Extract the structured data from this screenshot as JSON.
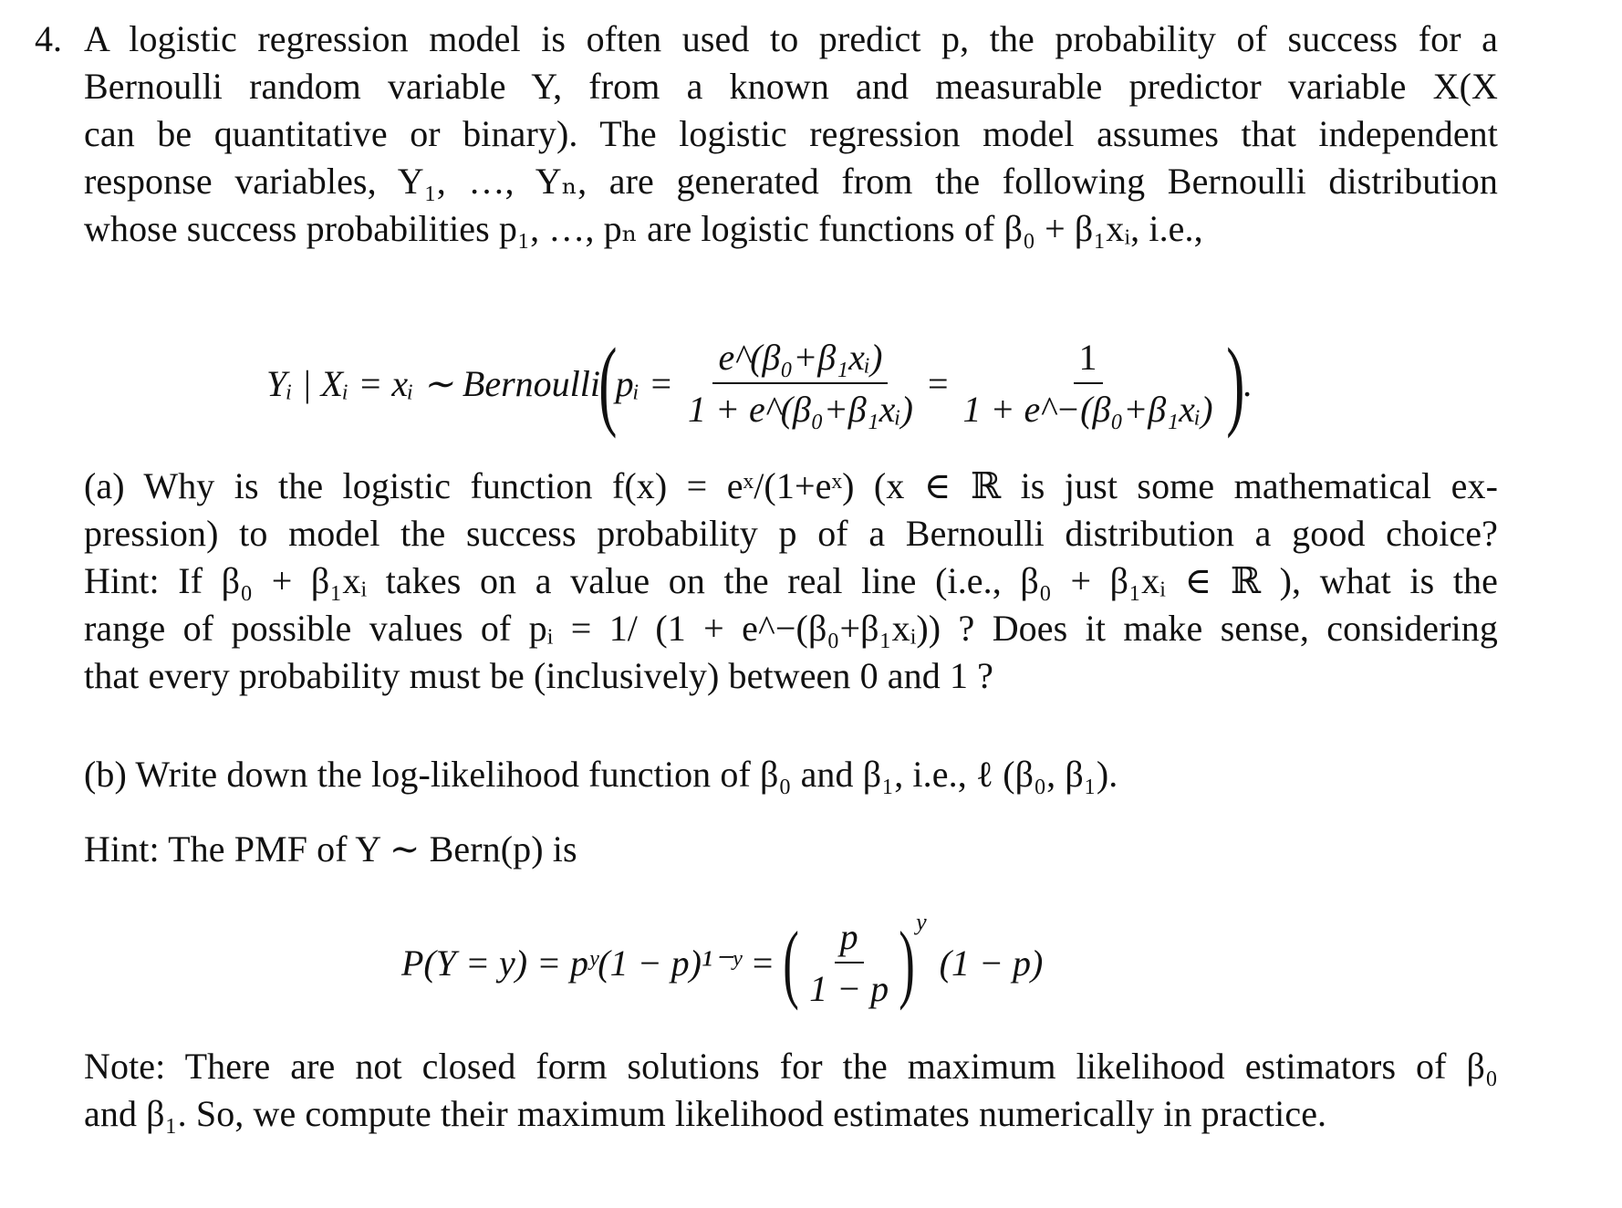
{
  "problem": {
    "number": "4.",
    "intro_lines": [
      "A logistic regression model is often used to predict p, the probability of success for a",
      "Bernoulli random variable Y, from a known and measurable predictor variable X(X",
      "can be quantitative or binary). The logistic regression model assumes that independent",
      "response variables, Y₁, …, Yₙ, are generated from the following Bernoulli distribution",
      "whose success probabilities p₁, …, pₙ are logistic functions of β₀ + β₁xᵢ, i.e.,"
    ],
    "model_equation": {
      "lhs": "Yᵢ | Xᵢ = xᵢ ∼ Bernoulli",
      "pi": "pᵢ =",
      "frac1_num": "e^(β₀+β₁xᵢ)",
      "frac1_den": "1 + e^(β₀+β₁xᵢ)",
      "frac2_num": "1",
      "frac2_den": "1 + e^−(β₀+β₁xᵢ)",
      "end": "."
    },
    "part_a": {
      "lines": [
        "(a) Why is the logistic function f(x) = eˣ/(1+eˣ) (x ∈ ℝ is just some mathematical ex-",
        "pression) to model the success probability p of a Bernoulli distribution a good choice?",
        "Hint: If β₀ + β₁xᵢ takes on a value on the real line (i.e., β₀ + β₁xᵢ ∈ ℝ ), what is the",
        "range of possible values of pᵢ = 1/ (1 + e^−(β₀+β₁xᵢ)) ? Does it make sense, considering",
        "that every probability must be (inclusively) between 0 and 1 ?"
      ]
    },
    "part_b": {
      "line": "(b) Write down the log-likelihood function of β₀ and β₁, i.e., ℓ (β₀, β₁).",
      "hint": "Hint: The PMF of Y ∼ Bern(p) is"
    },
    "pmf_equation": {
      "lhs": "P(Y = y) = pʸ(1 − p)¹⁻ʸ =",
      "frac_num": "p",
      "frac_den": "1 − p",
      "exponent": "y",
      "tail": "(1 − p)"
    },
    "note_lines": [
      "Note: There are not closed form solutions for the maximum likelihood estimators of β₀",
      "and β₁. So, we compute their maximum likelihood estimates numerically in practice."
    ]
  }
}
